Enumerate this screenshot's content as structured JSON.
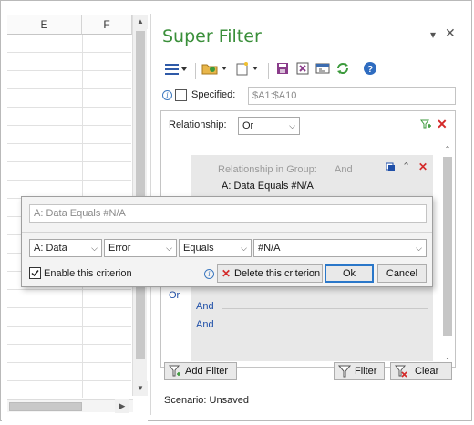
{
  "sheet": {
    "columns": [
      "E",
      "F"
    ]
  },
  "pane": {
    "title": "Super Filter",
    "specified_label": "Specified:",
    "range_value": "$A1:$A10",
    "relationship_label": "Relationship:",
    "relationship_value": "Or",
    "group_relationship_label": "Relationship in Group:",
    "group_relationship_value": "And",
    "group_criterion": "A: Data  Equals  #N/A",
    "or_label": "Or",
    "and_labels": [
      "And",
      "And",
      "And"
    ],
    "add_filter_label": "Add Filter",
    "filter_label": "Filter",
    "clear_label": "Clear",
    "scenario_label": "Scenario:",
    "scenario_value": "Unsaved"
  },
  "editor": {
    "summary": "A: Data  Equals  #N/A",
    "column_value": "A: Data",
    "type_value": "Error",
    "operator_value": "Equals",
    "value_value": "#N/A",
    "enable_label": "Enable this criterion",
    "delete_label": "Delete this criterion",
    "ok_label": "Ok",
    "cancel_label": "Cancel"
  },
  "colors": {
    "title_green": "#3a8f3a",
    "link_blue": "#1f4fa8",
    "delete_red": "#d42a2a"
  }
}
